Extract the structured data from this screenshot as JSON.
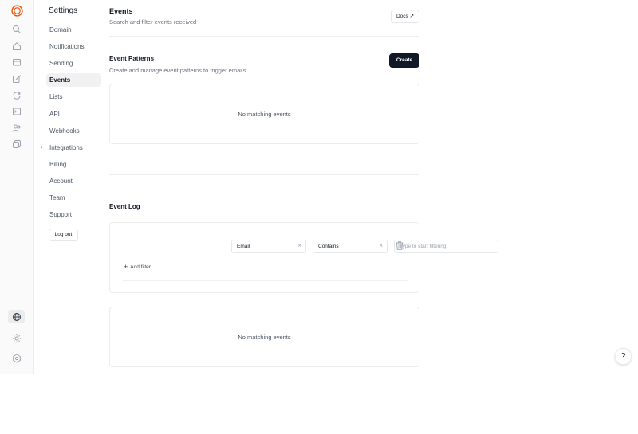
{
  "colors": {
    "accent": "#ea580c",
    "primary_button": "#111827",
    "active_nav_bg": "#f1f1f1"
  },
  "rail": {
    "logo": "brand-logo",
    "icons": [
      "search-icon",
      "home-icon",
      "inbox-icon",
      "edit-icon",
      "refresh-icon",
      "terminal-icon",
      "users-icon",
      "copy-icon"
    ],
    "bottom_icons": [
      "globe-icon",
      "sun-icon",
      "settings-icon"
    ]
  },
  "nav": {
    "title": "Settings",
    "items": [
      {
        "label": "Domain"
      },
      {
        "label": "Notifications"
      },
      {
        "label": "Sending"
      },
      {
        "label": "Events",
        "active": true
      },
      {
        "label": "Lists"
      },
      {
        "label": "API"
      },
      {
        "label": "Webhooks"
      },
      {
        "label": "Integrations",
        "expandable": true
      },
      {
        "label": "Billing"
      },
      {
        "label": "Account"
      },
      {
        "label": "Team"
      },
      {
        "label": "Support"
      }
    ],
    "logout": "Log out"
  },
  "header": {
    "title": "Events",
    "subtitle": "Search and filter events received",
    "docs_label": "Docs ↗"
  },
  "patterns": {
    "title": "Event Patterns",
    "subtitle": "Create and manage event patterns to trigger emails",
    "create_label": "Create",
    "empty_text": "No matching events"
  },
  "log": {
    "title": "Event Log",
    "filter": {
      "field": "Email",
      "operator": "Contains",
      "value_placeholder": "Type to start filtering"
    },
    "add_filter": "Add filter",
    "empty_text": "No matching events"
  },
  "help_label": "?"
}
